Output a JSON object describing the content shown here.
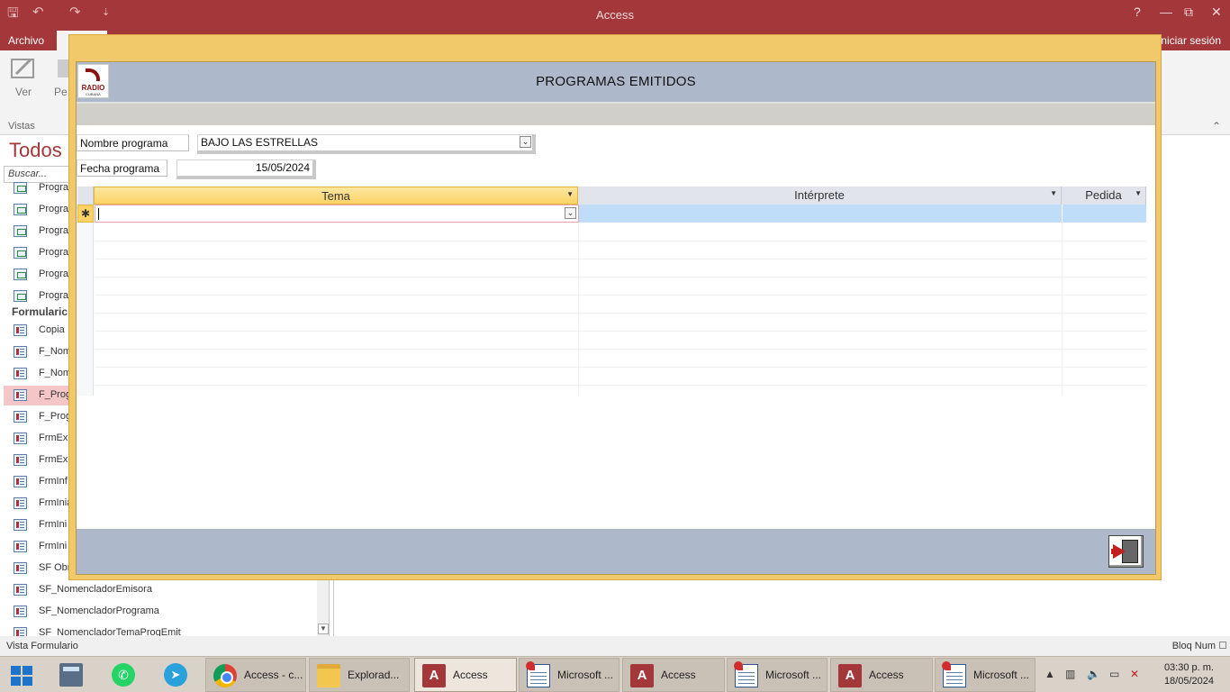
{
  "titlebar": {
    "app_title": "Access",
    "help": "?",
    "minimize": "—",
    "restore": "⧉",
    "close": "✕",
    "qa_save": "🖫",
    "qa_undo": "↶",
    "qa_redo": "↷",
    "qa_more": "⇣"
  },
  "tabs": {
    "file": "Archivo",
    "sign_in": "niciar sesión"
  },
  "ribbon": {
    "view_label": "Ver",
    "paste_label": "Pe",
    "group_label": "Vistas",
    "collapse": "⌃"
  },
  "navpane": {
    "title": "Todos l",
    "search_placeholder": "Buscar...",
    "section_forms": "Formularic",
    "query_items": [
      "Progra",
      "Progra",
      "Progra",
      "Progra",
      "Progra",
      "Progra"
    ],
    "form_items": [
      "Copia",
      "F_Nom",
      "F_Nom",
      "F_Prog",
      "F_Prog",
      "FrmExp",
      "FrmExp",
      "FrmInf",
      "FrmInia",
      "FrmIni",
      "FrmIni",
      "SF Obr",
      "SF_NomencladorEmisora",
      "SF_NomencladorPrograma",
      "SF_NomencladorTemaProgEmit"
    ],
    "selected_index": 3
  },
  "form": {
    "title": "PROGRAMAS EMITIDOS",
    "logo_text": "RADIO",
    "logo_sub": "CUBANA",
    "program_name_label": "Nombre programa",
    "program_name_value": "BAJO LAS ESTRELLAS",
    "program_date_label": "Fecha programa",
    "program_date_value": "15/05/2024",
    "grid": {
      "columns": [
        "Tema",
        "Intérprete",
        "Pedida"
      ],
      "new_row_marker": "✱"
    }
  },
  "statusbar": {
    "left": "Vista Formulario",
    "right": "Bloq Num"
  },
  "taskbar": {
    "items": [
      {
        "label": "Access - c...",
        "icon": "chrome-icon"
      },
      {
        "label": "Explorad...",
        "icon": "folder-icon"
      },
      {
        "label": "Access",
        "icon": "access-icon"
      },
      {
        "label": "Microsoft ...",
        "icon": "msaccess-form-icon"
      },
      {
        "label": "Access",
        "icon": "access-icon"
      },
      {
        "label": "Microsoft ...",
        "icon": "msaccess-form-icon"
      },
      {
        "label": "Access",
        "icon": "access-icon"
      },
      {
        "label": "Microsoft ...",
        "icon": "msaccess-form-icon"
      }
    ],
    "access_letter": "A",
    "time": "03:30 p. m.",
    "date": "18/05/2024"
  }
}
